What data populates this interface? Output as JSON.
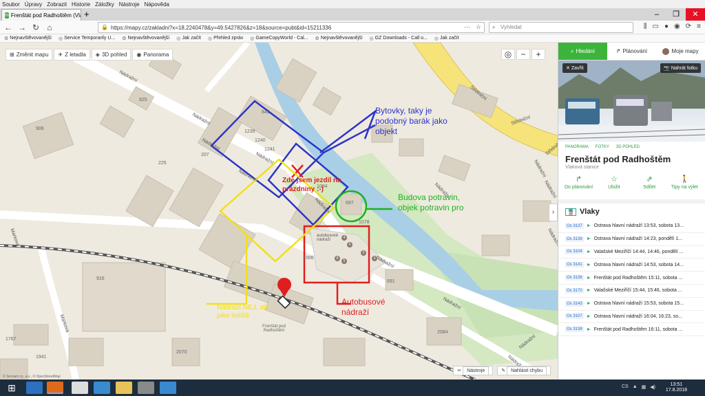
{
  "browser": {
    "menu": [
      "Soubor",
      "Úpravy",
      "Zobrazit",
      "Historie",
      "Záložky",
      "Nástroje",
      "Nápověda"
    ],
    "tab_title": "Frenštát pod Radhoštěm (Vlakov",
    "url": "https://mapy.cz/zakladni?x=18.2240478&y=49.5427826&z=18&source=pubt&id=15211336",
    "search_placeholder": "Vyhledat",
    "bookmarks": [
      "Nejnavštěvovanější",
      "Service Temporarily U...",
      "Nejnavštěvovanější",
      "Jak začít",
      "Přehled zpráv",
      "GameCopyWorld - Cal...",
      "Nejnavštěvovanější",
      "GZ Downloads - Call o...",
      "Jak začít"
    ]
  },
  "map": {
    "toolbar": [
      "Změnit mapu",
      "Z letadla",
      "3D pohled",
      "Panorama"
    ],
    "zoom_in": "+",
    "zoom_out": "−",
    "footer": {
      "tools": "Nástroje",
      "report": "Nahlásit chybu"
    },
    "copyright": "© Seznam.cz, a.s., © OpenStreetMap",
    "streets": [
      "Nádražní",
      "Nádražní",
      "Nádražní",
      "Nádražní",
      "Nádražní",
      "Nádražní",
      "Nádražní",
      "Nádražní",
      "Nádražní",
      "Nádražní",
      "Nádražní",
      "Nádražní",
      "Nádražní",
      "Střelniční",
      "Střelniční",
      "Střelniční",
      "Markova",
      "Markova",
      "Nádražní"
    ],
    "house_numbers": [
      "842",
      "906",
      "825",
      "225",
      "207",
      "1239",
      "1240",
      "1241",
      "1084",
      "697",
      "1078",
      "691",
      "2070",
      "1767",
      "1941",
      "2084",
      "916",
      "1006"
    ],
    "station_label": "Frenštát pod Radhoštěm",
    "bus_station_label": "autobusové nádraží",
    "bus_stops": [
      "4",
      "6",
      "2",
      "5",
      "8",
      "3"
    ]
  },
  "annotations": {
    "blue": "Bytovky, taky je podobný barák jako objekt",
    "red_top": "Zde jsem jezdil na prázdniny :-)",
    "green": "Budova potravin, objek potravin pro",
    "yellow": "Nádraží NEJ, ale jako letiště",
    "red_bottom": "Autobusové nádraží"
  },
  "panel": {
    "tabs": [
      "Hledání",
      "Plánování",
      "Moje mapy"
    ],
    "close": "Zavřít",
    "upload": "Nahrát fotku",
    "links": [
      "PANORAMA",
      "FOTKY",
      "3D POHLED"
    ],
    "title": "Frenštát pod Radhoštěm",
    "subtitle": "Vlaková stanice",
    "actions": [
      "Do plánování",
      "Uložit",
      "Sdílet",
      "Tipy na výlet"
    ],
    "trains_heading": "Vlaky",
    "trains": [
      {
        "num": "Os 3137",
        "text": "Ostrava hlavní nádraží 13:53, sobota 13..."
      },
      {
        "num": "Os 3139",
        "text": "Ostrava hlavní nádraží 14:23, pondělí 1..."
      },
      {
        "num": "Os 3104",
        "text": "Valašské Meziříčí 14:44, 14:46, pondělí ..."
      },
      {
        "num": "Os 3141",
        "text": "Ostrava hlavní nádraží 14:53, sobota 14..."
      },
      {
        "num": "Os 3136",
        "text": "Frenštát pod Radhoštěm 15:11, sobota ..."
      },
      {
        "num": "Os 3170",
        "text": "Valašské Meziříčí 15:44, 15:46, sobota ..."
      },
      {
        "num": "Os 3143",
        "text": "Ostrava hlavní nádraží 15:53, sobota 15..."
      },
      {
        "num": "Os 3107",
        "text": "Ostrava hlavní nádraží 16:04, 16:23, so..."
      },
      {
        "num": "Os 3138",
        "text": "Frenštát pod Radhoštěm 16:11, sobota ..."
      }
    ]
  },
  "taskbar": {
    "lang": "CS",
    "time": "13:51",
    "date": "17.8.2018"
  }
}
